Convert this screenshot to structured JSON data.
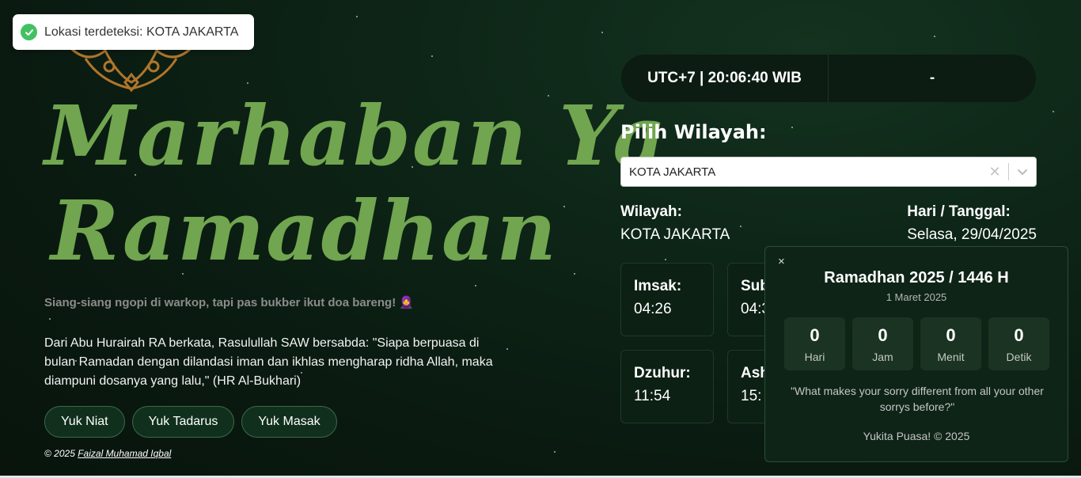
{
  "toast": {
    "text": "Lokasi terdeteksi: KOTA JAKARTA",
    "icon": "check-circle-icon",
    "color": "#43c162"
  },
  "hero": {
    "title_line1": "Marhaban Ya",
    "title_line2": "Ramadhan",
    "title_color": "#71a54f",
    "tagline": "Siang-siang ngopi di warkop, tapi pas bukber ikut doa bareng! 🧕",
    "hadith": "Dari Abu Hurairah RA berkata, Rasulullah SAW bersabda: \"Siapa berpuasa di bulan Ramadan dengan dilandasi iman dan ikhlas mengharap ridha Allah, maka diampuni dosanya yang lalu,\" (HR Al-Bukhari)",
    "buttons": [
      "Yuk Niat",
      "Yuk Tadarus",
      "Yuk Masak"
    ],
    "copyright_prefix": "© 2025",
    "copyright_link": "Faizal Muhamad Iqbal"
  },
  "clock": {
    "time": "UTC+7 | 20:06:40 WIB",
    "right": "-"
  },
  "region": {
    "heading": "Pilih Wilayah:",
    "selected": "KOTA JAKARTA",
    "wilayah_label": "Wilayah:",
    "wilayah_value": "KOTA JAKARTA",
    "date_label": "Hari / Tanggal:",
    "date_value": "Selasa, 29/04/2025"
  },
  "prayer_times": [
    {
      "label": "Imsak:",
      "time": "04:26"
    },
    {
      "label": "Sub",
      "time": "04:3"
    },
    {
      "label": "Dzuhur:",
      "time": "11:54"
    },
    {
      "label": "Ash",
      "time": "15:"
    }
  ],
  "popup": {
    "close": "×",
    "title": "Ramadhan 2025 / 1446 H",
    "subtitle": "1 Maret 2025",
    "countdown": [
      {
        "value": "0",
        "unit": "Hari"
      },
      {
        "value": "0",
        "unit": "Jam"
      },
      {
        "value": "0",
        "unit": "Menit"
      },
      {
        "value": "0",
        "unit": "Detik"
      }
    ],
    "quote": "\"What makes your sorry different from all your other sorrys before?\"",
    "footer": "Yukita Puasa! © 2025"
  }
}
